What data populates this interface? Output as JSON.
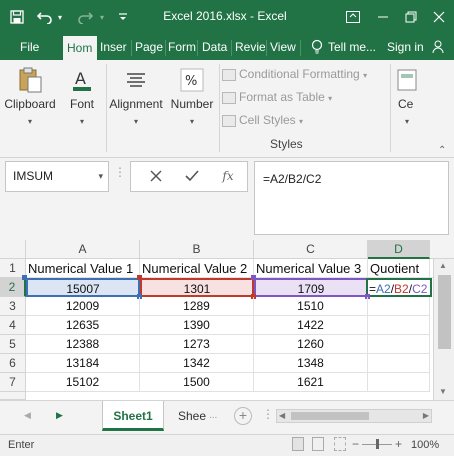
{
  "window": {
    "title": "Excel 2016.xlsx - Excel",
    "colors": {
      "brand": "#217346"
    }
  },
  "qat": {
    "save_icon": "save-icon",
    "undo_icon": "undo-icon",
    "redo_icon": "redo-icon"
  },
  "ribbon_tabs": [
    {
      "label": "File"
    },
    {
      "label": "Hom",
      "active": true
    },
    {
      "label": "Inser"
    },
    {
      "label": "Page"
    },
    {
      "label": "Form"
    },
    {
      "label": "Data"
    },
    {
      "label": "Revie"
    },
    {
      "label": "View"
    },
    {
      "label": "Tell me..."
    },
    {
      "label": "Sign in"
    }
  ],
  "ribbon": {
    "clipboard": "Clipboard",
    "font": "Font",
    "alignment": "Alignment",
    "number": "Number",
    "conditional_formatting": "Conditional Formatting",
    "format_as_table": "Format as Table",
    "cell_styles": "Cell Styles",
    "styles_group": "Styles",
    "cells": "Ce"
  },
  "formula_bar": {
    "name_box": "IMSUM",
    "cancel_icon": "close-icon",
    "enter_icon": "check-icon",
    "fx_label": "fx",
    "formula": "=A2/B2/C2"
  },
  "sheet": {
    "columns": [
      "A",
      "B",
      "C",
      "D"
    ],
    "selected_column": "D",
    "rows": [
      "1",
      "2",
      "3",
      "4",
      "5",
      "6",
      "7"
    ],
    "selected_row": "2",
    "header": [
      "Numerical Value 1",
      "Numerical Value 2",
      "Numerical Value 3",
      "Quotient"
    ],
    "data": [
      [
        "15007",
        "1301",
        "1709"
      ],
      [
        "12009",
        "1289",
        "1510"
      ],
      [
        "12635",
        "1390",
        "1422"
      ],
      [
        "12388",
        "1273",
        "1260"
      ],
      [
        "13184",
        "1342",
        "1348"
      ],
      [
        "15102",
        "1500",
        "1621"
      ]
    ],
    "active_formula_parts": [
      "=",
      "A2",
      "/",
      "B2",
      "/",
      "C2"
    ],
    "ref_colors": {
      "a": "#3d6fb4",
      "b": "#c0392b",
      "c": "#7e57c2"
    }
  },
  "sheet_tabs": [
    {
      "label": "Sheet1",
      "active": true
    },
    {
      "label": "Shee"
    }
  ],
  "status": {
    "mode": "Enter",
    "zoom": "100%"
  }
}
